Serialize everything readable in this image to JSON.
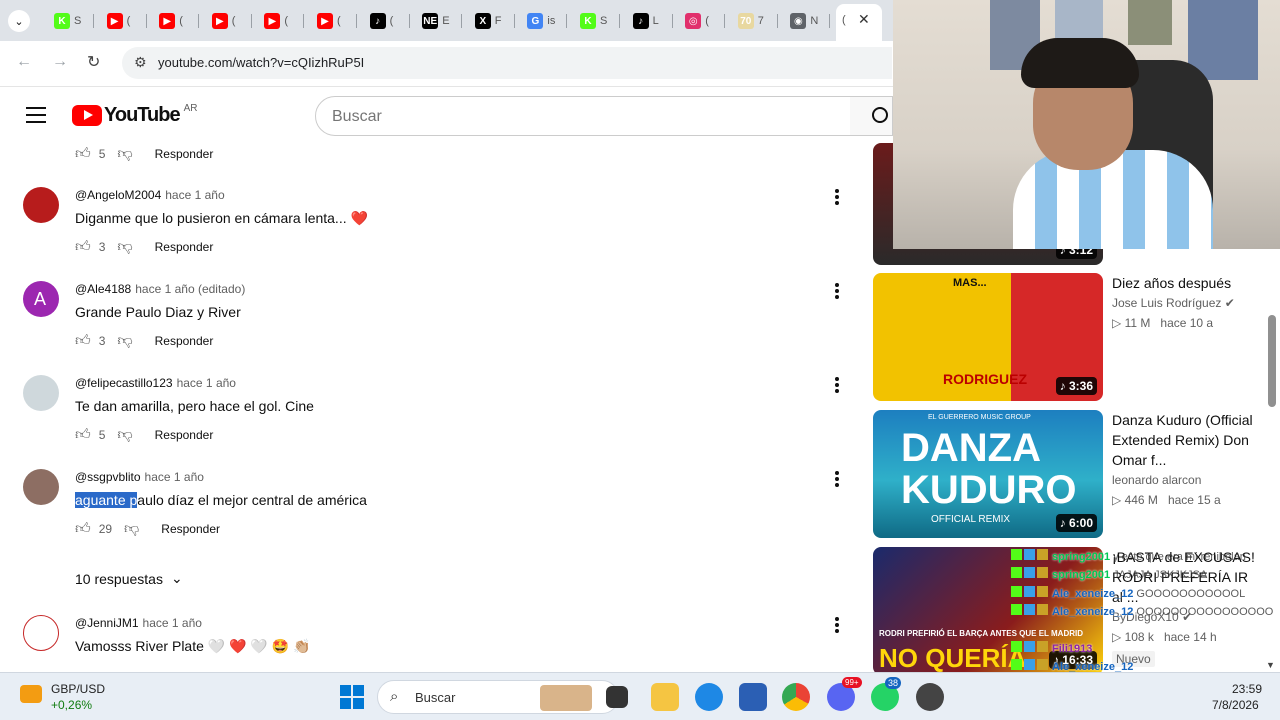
{
  "browser": {
    "tabs": [
      {
        "fav": "K",
        "color": "#53fc18",
        "letter": "S"
      },
      {
        "fav": "▶",
        "color": "#ff0000",
        "letter": "("
      },
      {
        "fav": "▶",
        "color": "#ff0000",
        "letter": "("
      },
      {
        "fav": "▶",
        "color": "#ff0000",
        "letter": "("
      },
      {
        "fav": "▶",
        "color": "#ff0000",
        "letter": "("
      },
      {
        "fav": "▶",
        "color": "#ff0000",
        "letter": "("
      },
      {
        "fav": "♪",
        "color": "#000000",
        "letter": "("
      },
      {
        "fav": "NE",
        "color": "#000000",
        "letter": "E"
      },
      {
        "fav": "X",
        "color": "#000000",
        "letter": "F"
      },
      {
        "fav": "G",
        "color": "#4285f4",
        "letter": "is"
      },
      {
        "fav": "K",
        "color": "#53fc18",
        "letter": "S"
      },
      {
        "fav": "♪",
        "color": "#000000",
        "letter": "L"
      },
      {
        "fav": "◎",
        "color": "#e1306c",
        "letter": "("
      },
      {
        "fav": "70",
        "color": "#e8d8a0",
        "letter": "7"
      },
      {
        "fav": "◉",
        "color": "#5f6368",
        "letter": "N"
      }
    ],
    "active_tab_letter": "(",
    "url": "youtube.com/watch?v=cQIizhRuP5I"
  },
  "youtube": {
    "logo_text": "YouTube",
    "region": "AR",
    "search_placeholder": "Buscar"
  },
  "top_actions": {
    "likes": "5",
    "reply": "Responder"
  },
  "comments": [
    {
      "author": "@AngeloM2004",
      "time": "hace 1 año",
      "text": "Diganme que lo pusieron en cámara lenta... ❤️",
      "likes": "3",
      "reply": "Responder"
    },
    {
      "author": "@Ale4188",
      "time": "hace 1 año (editado)",
      "text": "Grande Paulo Diaz y River",
      "likes": "3",
      "reply": "Responder",
      "initial": "A"
    },
    {
      "author": "@felipecastillo123",
      "time": "hace 1 año",
      "text": "Te dan amarilla, pero hace el gol. Cine",
      "likes": "5",
      "reply": "Responder"
    },
    {
      "author": "@ssgpvblito",
      "time": "hace 1 año",
      "text_selected": "aguante p",
      "text_rest": "aulo díaz el mejor central de américa",
      "likes": "29",
      "reply": "Responder"
    },
    {
      "author": "@JenniJM1",
      "time": "hace 1 año",
      "text": "Vamosss River Plate 🤍 ❤️ 🤍 🤩 👏🏼"
    }
  ],
  "replies_toggle": "10 respuestas",
  "sidebar": [
    {
      "duration": "3:12"
    },
    {
      "title": "Diez años después",
      "channel": "Jose Luis Rodríguez",
      "views": "11 M",
      "age": "hace 10 a",
      "duration": "3:36",
      "thumb_text_top": "MAS...",
      "thumb_text_bottom": "RODRIGUEZ"
    },
    {
      "title": "Danza Kuduro (Official Extended Remix) Don Omar f...",
      "channel": "leonardo alarcon",
      "views": "446 M",
      "age": "hace 15 a",
      "duration": "6:00",
      "thumb_text_top": "DANZA",
      "thumb_text_mid": "KUDURO",
      "thumb_text_bottom": "OFFICIAL REMIX",
      "thumb_text_label": "EL GUERRERO MUSIC GROUP"
    },
    {
      "title": "¡BASTA de EXCUSAS! RODRI PREFERÍA IR al ...",
      "channel": "ByDiegoX10",
      "views": "108 k",
      "age": "hace 14 h",
      "duration": "16:33",
      "badge": "Nuevo",
      "thumb_text_top": "RODRI PREFIRIÓ EL BARÇA ANTES QUE EL MADRID",
      "thumb_text_bottom": "NO QUERÍA"
    }
  ],
  "chat": [
    {
      "user": "spring2001",
      "msg": "y este que era mi renibelan",
      "color": "#00c853"
    },
    {
      "user": "spring2001",
      "msg": "JAJAJA JSKJKJSA",
      "color": "#00c853"
    },
    {
      "user": "Ale_xeneize_12",
      "msg": "GOOOOOOOOOOOL",
      "color": "#1565c0"
    },
    {
      "user": "Ale_xeneize_12",
      "msg": "OOOOOOOOOOOOOOOO",
      "color": "#1565c0"
    },
    {
      "user": "Fili1913",
      "msg": "",
      "color": "#8e24aa"
    },
    {
      "user": "Ale_xeneize_12",
      "msg": "",
      "color": "#1565c0"
    },
    {
      "user": "Ale_xeneize_12",
      "msg": "",
      "color": "#1565c0"
    },
    {
      "user": "Ale_xeneize_12",
      "msg": "",
      "color": "#1565c0"
    }
  ],
  "taskbar": {
    "widget_title": "GBP/USD",
    "widget_value": "+0,26%",
    "search": "Buscar",
    "time": "23:59",
    "date": "7/8/2026",
    "whatsapp_badge": "38",
    "discord_badge": "99+"
  }
}
